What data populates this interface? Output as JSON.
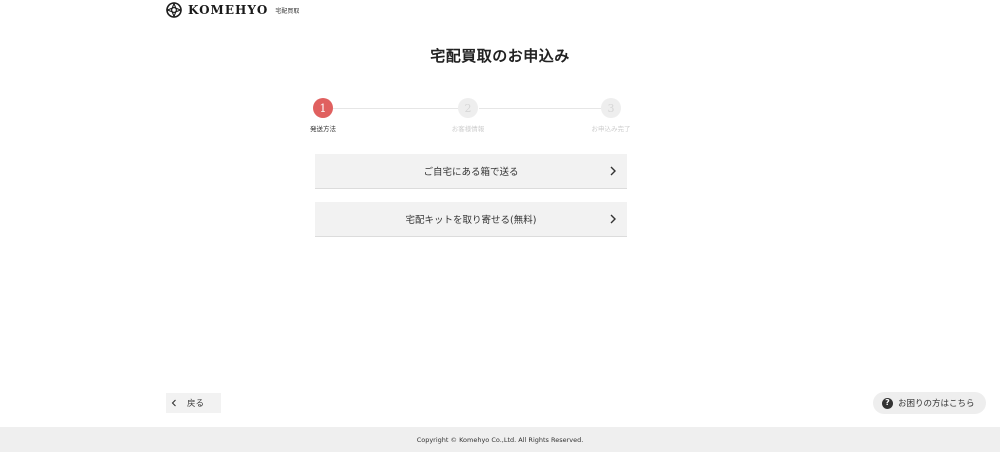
{
  "header": {
    "brand_name": "KOMEHYO",
    "brand_sub": "宅配買取",
    "logo_icon": "komehyo-logo-icon"
  },
  "title": "宅配買取のお申込み",
  "stepper": {
    "steps": [
      {
        "number": "1",
        "label": "発送方法",
        "state": "active"
      },
      {
        "number": "2",
        "label": "お客様情報",
        "state": "inactive"
      },
      {
        "number": "3",
        "label": "お申込み完了",
        "state": "inactive"
      }
    ],
    "active_color": "#e0605f"
  },
  "options": [
    {
      "label": "ご自宅にある箱で送る",
      "icon": "chevron-right-icon"
    },
    {
      "label": "宅配キットを取り寄せる(無料)",
      "icon": "chevron-right-icon"
    }
  ],
  "back_button": {
    "label": "戻る",
    "icon": "chevron-left-icon"
  },
  "help_button": {
    "label": "お困りの方はこちら",
    "icon_glyph": "?",
    "icon": "question-circle-icon"
  },
  "footer": {
    "copyright": "Copyright © Komehyo Co.,Ltd. All Rights Reserved."
  }
}
